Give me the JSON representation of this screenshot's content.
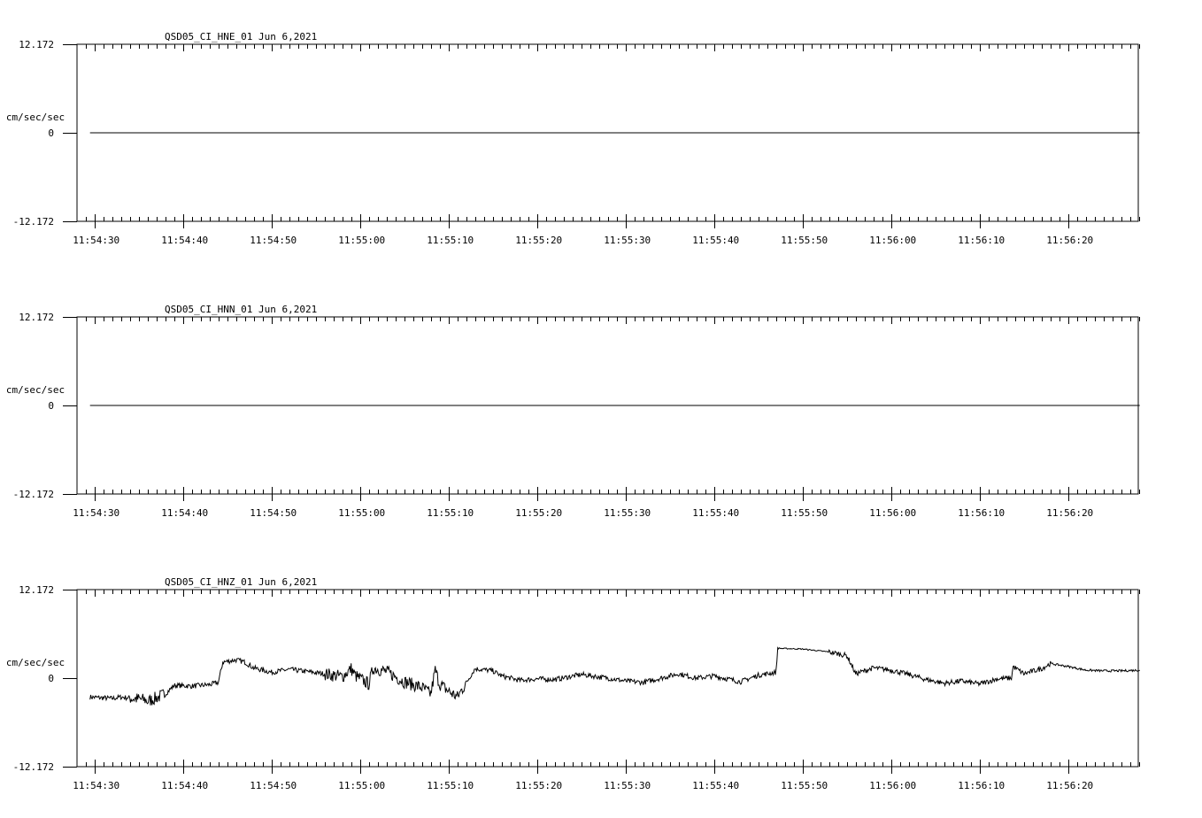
{
  "chart_data": [
    {
      "type": "line",
      "title": "QSD05_CI_HNE_01  Jun 6,2021",
      "ylabel": "cm/sec/sec",
      "ylim": [
        -12.172,
        12.172
      ],
      "y_ticks": [
        "12.172",
        "0",
        "-12.172"
      ],
      "x_ticks": [
        "11:54:30",
        "11:54:40",
        "11:54:50",
        "11:55:00",
        "11:55:10",
        "11:55:20",
        "11:55:30",
        "11:55:40",
        "11:55:50",
        "11:56:00",
        "11:56:10",
        "11:56:20"
      ],
      "xlim_seconds": [
        -1.9,
        118.1
      ],
      "series": [
        {
          "x": [
            -0.5,
            118.1
          ],
          "values": [
            0,
            0
          ]
        }
      ]
    },
    {
      "type": "line",
      "title": "QSD05_CI_HNN_01  Jun 6,2021",
      "ylabel": "cm/sec/sec",
      "ylim": [
        -12.172,
        12.172
      ],
      "y_ticks": [
        "12.172",
        "0",
        "-12.172"
      ],
      "x_ticks": [
        "11:54:30",
        "11:54:40",
        "11:54:50",
        "11:55:00",
        "11:55:10",
        "11:55:20",
        "11:55:30",
        "11:55:40",
        "11:55:50",
        "11:56:00",
        "11:56:10",
        "11:56:20"
      ],
      "xlim_seconds": [
        -1.9,
        118.1
      ],
      "series": [
        {
          "x": [
            -0.5,
            118.1
          ],
          "values": [
            0,
            0
          ]
        }
      ]
    },
    {
      "type": "line",
      "title": "QSD05_CI_HNZ_01  Jun 6,2021",
      "ylabel": "cm/sec/sec",
      "ylim": [
        -12.172,
        12.172
      ],
      "y_ticks": [
        "12.172",
        "0",
        "-12.172"
      ],
      "x_ticks": [
        "11:54:30",
        "11:54:40",
        "11:54:50",
        "11:55:00",
        "11:55:10",
        "11:55:20",
        "11:55:30",
        "11:55:40",
        "11:55:50",
        "11:56:00",
        "11:56:10",
        "11:56:20"
      ],
      "xlim_seconds": [
        -1.9,
        118.1
      ],
      "series": [
        {
          "x": [
            -0.5,
            2.0,
            3.0,
            5.8,
            6.0,
            8.0,
            9.0,
            11.0,
            13.0,
            14.0,
            14.5,
            16.0,
            17.0,
            18.0,
            20.0,
            22.0,
            24.0,
            26.0,
            28.0,
            29.0,
            29.5,
            31.0,
            31.5,
            33.0,
            35.0,
            37.0,
            38.0,
            38.5,
            39.0,
            40.0,
            41.0,
            43.0,
            45.0,
            46.0,
            47.0,
            48.0,
            50.0,
            52.0,
            55.0,
            58.0,
            60.0,
            62.0,
            64.0,
            66.0,
            68.0,
            70.0,
            73.0,
            75.0,
            77.0,
            77.2,
            80.0,
            83.0,
            85.0,
            85.5,
            86.0,
            88.0,
            90.0,
            92.0,
            94.0,
            96.0,
            98.0,
            100.0,
            102.0,
            103.6,
            103.8,
            105.0,
            107.0,
            108.0,
            110.0,
            112.0,
            114.0,
            116.0,
            118.1
          ],
          "values": [
            -2.6,
            -2.8,
            -2.6,
            -3.0,
            -3.2,
            -2.2,
            -1.0,
            -1.1,
            -0.9,
            -0.6,
            2.2,
            2.5,
            2.2,
            1.4,
            0.8,
            1.2,
            0.9,
            0.6,
            0.2,
            1.3,
            0.3,
            -0.8,
            1.4,
            0.9,
            -0.5,
            -1.3,
            -2.2,
            1.1,
            -0.8,
            -1.8,
            -2.6,
            1.3,
            1.0,
            0.3,
            0.0,
            -0.3,
            -0.1,
            -0.2,
            0.5,
            0.0,
            -0.4,
            -0.6,
            0.0,
            0.6,
            0.0,
            0.3,
            -0.5,
            0.4,
            0.8,
            4.1,
            4.0,
            3.6,
            3.1,
            1.9,
            0.6,
            1.4,
            1.1,
            0.5,
            -0.2,
            -0.7,
            -0.4,
            -0.8,
            -0.1,
            0.0,
            1.6,
            0.6,
            1.3,
            2.0,
            1.6,
            1.1,
            1.0,
            1.0,
            1.1
          ]
        }
      ]
    }
  ]
}
